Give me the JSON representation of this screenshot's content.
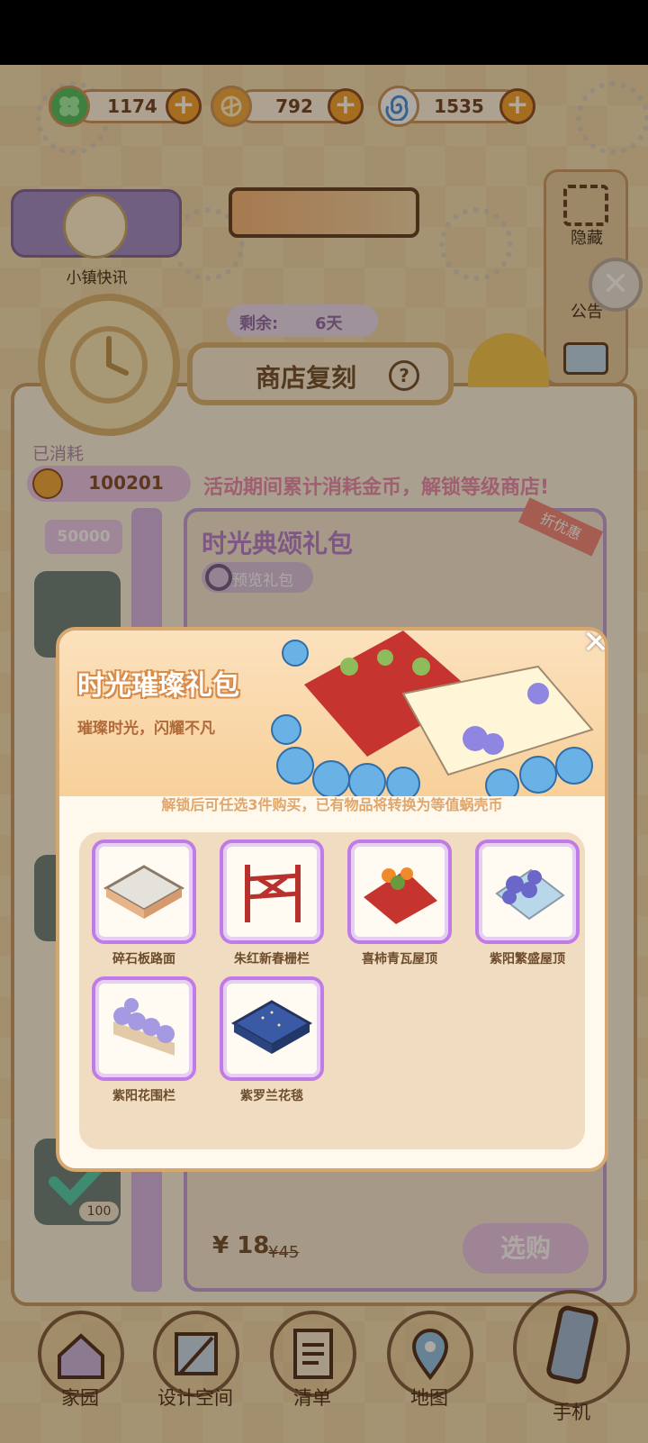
{
  "currencies": [
    {
      "name": "clover",
      "value": "1174",
      "icon": "clover-icon",
      "color": "#4dbf5f"
    },
    {
      "name": "coin",
      "value": "792",
      "icon": "shell-coin-icon",
      "color": "#f0a63b"
    },
    {
      "name": "swirl",
      "value": "1535",
      "icon": "swirl-icon",
      "color": "#52a8e6"
    }
  ],
  "news": {
    "label": "小镇快讯"
  },
  "side": {
    "hide_label": "隐藏",
    "announce_label": "公告"
  },
  "shop": {
    "remaining_label": "剩余:",
    "remaining_value": "6天",
    "title": "商店复刻",
    "help": "?",
    "consumed_label": "已消耗",
    "consumed_value": "100201",
    "hint": "活动期间累计消耗金币，解锁等级商店!",
    "tier_value": "50000",
    "tier_badge_count": "100",
    "pack_title": "时光典颂礼包",
    "preview_label": "预览礼包",
    "discount_label": "折优惠",
    "price": "¥ 18",
    "old_price": "¥45",
    "buy_label": "选购"
  },
  "modal": {
    "title": "时光璀璨礼包",
    "subtitle": "璀璨时光，闪耀不凡",
    "notice": "解锁后可任选3件购买，已有物品将转换为等值蜗壳币",
    "items": [
      {
        "label": "碎石板路面",
        "icon": "stone-path-icon"
      },
      {
        "label": "朱红新春栅栏",
        "icon": "red-fence-icon"
      },
      {
        "label": "喜柿青瓦屋顶",
        "icon": "persimmon-roof-icon"
      },
      {
        "label": "紫阳繁盛屋顶",
        "icon": "hydrangea-roof-icon"
      },
      {
        "label": "紫阳花围栏",
        "icon": "hydrangea-fence-icon"
      },
      {
        "label": "紫罗兰花毯",
        "icon": "violet-rug-icon"
      }
    ]
  },
  "nav": [
    {
      "label": "家园",
      "icon": "home-icon"
    },
    {
      "label": "设计空间",
      "icon": "design-icon"
    },
    {
      "label": "清单",
      "icon": "list-icon"
    },
    {
      "label": "地图",
      "icon": "map-pin-icon"
    },
    {
      "label": "手机",
      "icon": "phone-icon"
    }
  ]
}
